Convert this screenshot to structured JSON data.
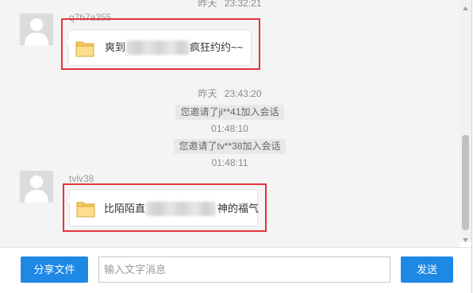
{
  "chat": {
    "time_top": "昨天 23:32:21",
    "messages": [
      {
        "username": "q7h7a355",
        "file_name_start": "爽到",
        "file_name_end": "疯狂约约~~"
      },
      {
        "username": "tvlv38",
        "file_name_start": "比陌陌直",
        "file_name_end": "神的福气"
      }
    ],
    "time_2": "昨天 23:43:20",
    "notices": [
      "您邀请了ji**41加入会话",
      "您邀请了tv**38加入会话"
    ],
    "notice_times": [
      "01:48:10",
      "01:48:11"
    ]
  },
  "composer": {
    "share_label": "分享文件",
    "input_value": "",
    "input_placeholder": "输入文字消息",
    "send_label": "发送"
  },
  "icons": {
    "avatar": "user-avatar-placeholder-icon",
    "file": "folder-icon",
    "scroll_up": "scroll-up-arrow-icon",
    "scroll_down": "scroll-down-arrow-icon"
  },
  "colors": {
    "primary_blue": "#1e88e5",
    "highlight_red": "#e5333b",
    "chat_background": "#f4f4f4"
  }
}
